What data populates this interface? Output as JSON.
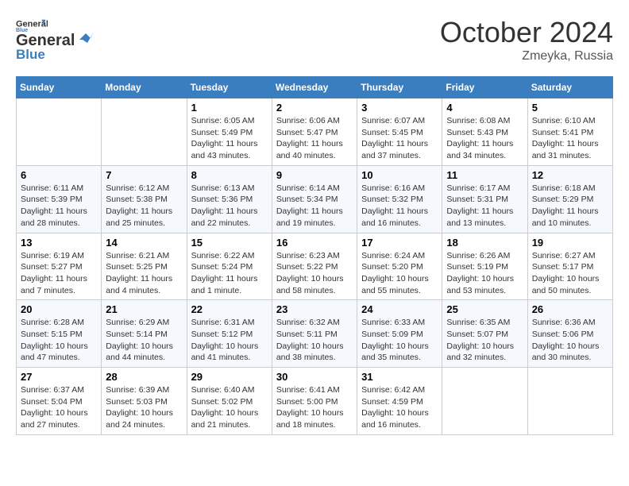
{
  "header": {
    "logo_line1": "General",
    "logo_line2": "Blue",
    "month": "October 2024",
    "location": "Zmeyka, Russia"
  },
  "weekdays": [
    "Sunday",
    "Monday",
    "Tuesday",
    "Wednesday",
    "Thursday",
    "Friday",
    "Saturday"
  ],
  "weeks": [
    [
      {
        "day": "",
        "sunrise": "",
        "sunset": "",
        "daylight": ""
      },
      {
        "day": "",
        "sunrise": "",
        "sunset": "",
        "daylight": ""
      },
      {
        "day": "1",
        "sunrise": "Sunrise: 6:05 AM",
        "sunset": "Sunset: 5:49 PM",
        "daylight": "Daylight: 11 hours and 43 minutes."
      },
      {
        "day": "2",
        "sunrise": "Sunrise: 6:06 AM",
        "sunset": "Sunset: 5:47 PM",
        "daylight": "Daylight: 11 hours and 40 minutes."
      },
      {
        "day": "3",
        "sunrise": "Sunrise: 6:07 AM",
        "sunset": "Sunset: 5:45 PM",
        "daylight": "Daylight: 11 hours and 37 minutes."
      },
      {
        "day": "4",
        "sunrise": "Sunrise: 6:08 AM",
        "sunset": "Sunset: 5:43 PM",
        "daylight": "Daylight: 11 hours and 34 minutes."
      },
      {
        "day": "5",
        "sunrise": "Sunrise: 6:10 AM",
        "sunset": "Sunset: 5:41 PM",
        "daylight": "Daylight: 11 hours and 31 minutes."
      }
    ],
    [
      {
        "day": "6",
        "sunrise": "Sunrise: 6:11 AM",
        "sunset": "Sunset: 5:39 PM",
        "daylight": "Daylight: 11 hours and 28 minutes."
      },
      {
        "day": "7",
        "sunrise": "Sunrise: 6:12 AM",
        "sunset": "Sunset: 5:38 PM",
        "daylight": "Daylight: 11 hours and 25 minutes."
      },
      {
        "day": "8",
        "sunrise": "Sunrise: 6:13 AM",
        "sunset": "Sunset: 5:36 PM",
        "daylight": "Daylight: 11 hours and 22 minutes."
      },
      {
        "day": "9",
        "sunrise": "Sunrise: 6:14 AM",
        "sunset": "Sunset: 5:34 PM",
        "daylight": "Daylight: 11 hours and 19 minutes."
      },
      {
        "day": "10",
        "sunrise": "Sunrise: 6:16 AM",
        "sunset": "Sunset: 5:32 PM",
        "daylight": "Daylight: 11 hours and 16 minutes."
      },
      {
        "day": "11",
        "sunrise": "Sunrise: 6:17 AM",
        "sunset": "Sunset: 5:31 PM",
        "daylight": "Daylight: 11 hours and 13 minutes."
      },
      {
        "day": "12",
        "sunrise": "Sunrise: 6:18 AM",
        "sunset": "Sunset: 5:29 PM",
        "daylight": "Daylight: 11 hours and 10 minutes."
      }
    ],
    [
      {
        "day": "13",
        "sunrise": "Sunrise: 6:19 AM",
        "sunset": "Sunset: 5:27 PM",
        "daylight": "Daylight: 11 hours and 7 minutes."
      },
      {
        "day": "14",
        "sunrise": "Sunrise: 6:21 AM",
        "sunset": "Sunset: 5:25 PM",
        "daylight": "Daylight: 11 hours and 4 minutes."
      },
      {
        "day": "15",
        "sunrise": "Sunrise: 6:22 AM",
        "sunset": "Sunset: 5:24 PM",
        "daylight": "Daylight: 11 hours and 1 minute."
      },
      {
        "day": "16",
        "sunrise": "Sunrise: 6:23 AM",
        "sunset": "Sunset: 5:22 PM",
        "daylight": "Daylight: 10 hours and 58 minutes."
      },
      {
        "day": "17",
        "sunrise": "Sunrise: 6:24 AM",
        "sunset": "Sunset: 5:20 PM",
        "daylight": "Daylight: 10 hours and 55 minutes."
      },
      {
        "day": "18",
        "sunrise": "Sunrise: 6:26 AM",
        "sunset": "Sunset: 5:19 PM",
        "daylight": "Daylight: 10 hours and 53 minutes."
      },
      {
        "day": "19",
        "sunrise": "Sunrise: 6:27 AM",
        "sunset": "Sunset: 5:17 PM",
        "daylight": "Daylight: 10 hours and 50 minutes."
      }
    ],
    [
      {
        "day": "20",
        "sunrise": "Sunrise: 6:28 AM",
        "sunset": "Sunset: 5:15 PM",
        "daylight": "Daylight: 10 hours and 47 minutes."
      },
      {
        "day": "21",
        "sunrise": "Sunrise: 6:29 AM",
        "sunset": "Sunset: 5:14 PM",
        "daylight": "Daylight: 10 hours and 44 minutes."
      },
      {
        "day": "22",
        "sunrise": "Sunrise: 6:31 AM",
        "sunset": "Sunset: 5:12 PM",
        "daylight": "Daylight: 10 hours and 41 minutes."
      },
      {
        "day": "23",
        "sunrise": "Sunrise: 6:32 AM",
        "sunset": "Sunset: 5:11 PM",
        "daylight": "Daylight: 10 hours and 38 minutes."
      },
      {
        "day": "24",
        "sunrise": "Sunrise: 6:33 AM",
        "sunset": "Sunset: 5:09 PM",
        "daylight": "Daylight: 10 hours and 35 minutes."
      },
      {
        "day": "25",
        "sunrise": "Sunrise: 6:35 AM",
        "sunset": "Sunset: 5:07 PM",
        "daylight": "Daylight: 10 hours and 32 minutes."
      },
      {
        "day": "26",
        "sunrise": "Sunrise: 6:36 AM",
        "sunset": "Sunset: 5:06 PM",
        "daylight": "Daylight: 10 hours and 30 minutes."
      }
    ],
    [
      {
        "day": "27",
        "sunrise": "Sunrise: 6:37 AM",
        "sunset": "Sunset: 5:04 PM",
        "daylight": "Daylight: 10 hours and 27 minutes."
      },
      {
        "day": "28",
        "sunrise": "Sunrise: 6:39 AM",
        "sunset": "Sunset: 5:03 PM",
        "daylight": "Daylight: 10 hours and 24 minutes."
      },
      {
        "day": "29",
        "sunrise": "Sunrise: 6:40 AM",
        "sunset": "Sunset: 5:02 PM",
        "daylight": "Daylight: 10 hours and 21 minutes."
      },
      {
        "day": "30",
        "sunrise": "Sunrise: 6:41 AM",
        "sunset": "Sunset: 5:00 PM",
        "daylight": "Daylight: 10 hours and 18 minutes."
      },
      {
        "day": "31",
        "sunrise": "Sunrise: 6:42 AM",
        "sunset": "Sunset: 4:59 PM",
        "daylight": "Daylight: 10 hours and 16 minutes."
      },
      {
        "day": "",
        "sunrise": "",
        "sunset": "",
        "daylight": ""
      },
      {
        "day": "",
        "sunrise": "",
        "sunset": "",
        "daylight": ""
      }
    ]
  ]
}
